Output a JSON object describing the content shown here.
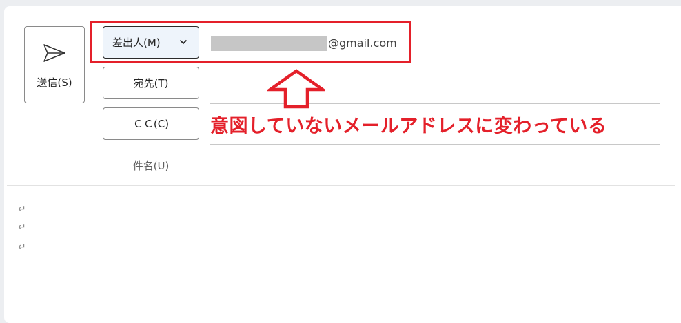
{
  "send": {
    "label": "送信(S)",
    "icon": "send-icon"
  },
  "from": {
    "label": "差出人(M)",
    "icon": "chevron-down-icon",
    "email_domain": "@gmail.com"
  },
  "to": {
    "label": "宛先(T)"
  },
  "cc": {
    "label": "ＣＣ(C)"
  },
  "subject": {
    "label": "件名(U)"
  },
  "annotation": {
    "text": "意図していないメールアドレスに変わっている",
    "color": "#e4202a"
  },
  "body": {
    "paragraph_marks": [
      "↵",
      "↵",
      "↵"
    ]
  }
}
